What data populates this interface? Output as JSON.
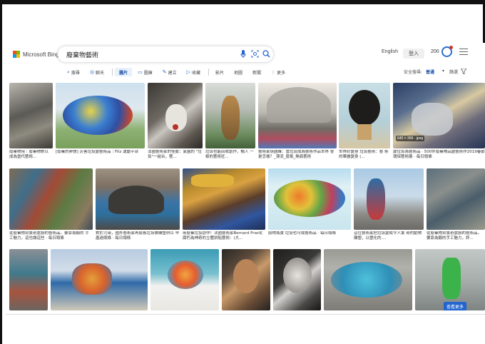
{
  "header": {
    "brand": "Microsoft Bing",
    "search_value": "廢棄物藝術",
    "language": "English",
    "signin": "登入",
    "points": "200"
  },
  "icons": {
    "mic": "microphone-icon",
    "visual": "visual-search-icon",
    "search": "search-icon",
    "reward": "rewards-icon",
    "menu": "hamburger-menu-icon",
    "filter": "filter-icon"
  },
  "colors": {
    "accent": "#2265d0",
    "ms_red": "#f25022",
    "ms_green": "#7fba00",
    "ms_blue": "#00a4ef",
    "ms_yellow": "#ffb900"
  },
  "tabs": [
    {
      "icon": "⌕",
      "label": "搜尋"
    },
    {
      "icon": "◎",
      "label": "聊天"
    },
    {
      "icon": "",
      "label": "圖片",
      "active": true
    },
    {
      "icon": "▭",
      "label": "圖庫"
    },
    {
      "icon": "✎",
      "label": "建立"
    },
    {
      "icon": "▷",
      "label": "收藏"
    },
    {
      "icon": "",
      "label": "影片"
    },
    {
      "icon": "",
      "label": "地圖"
    },
    {
      "icon": "",
      "label": "新聞"
    },
    {
      "icon": "⋮",
      "label": "更多"
    }
  ],
  "tools": {
    "safesearch_label": "安全搜尋:",
    "safesearch_value": "普通",
    "filter_label": "篩選"
  },
  "results": {
    "row1": [
      {
        "caption": "廢棄物用｜廢棄物對以 成為當代藝術..."
      },
      {
        "caption": "[廢棄的夢想] 災害垃圾變藝術品｜Fitz 運動平台"
      },
      {
        "caption": "法國藝術家的怪臉：家園的 \"垃圾\"一組合，藝..."
      },
      {
        "caption": "垃圾也能回收創作，暢人 一條的藝術狂..."
      },
      {
        "caption": "藝術家徐國峰：當垃圾成為藝術作品世界 會是怎樣？_漂流_廢氣_無痕藝術"
      },
      {
        "caption": "世界好變身 垃圾藝術：藝 術的華麗變身 (..."
      },
      {
        "caption": "變垃圾為藝術品 · 500件廢棄物品變藝術作2019春節 環保藝術展 · 每日頭條",
        "badge": "640 × 366 · jpeg"
      }
    ],
    "row2": [
      {
        "caption": "從廢棄物到驚奇震撼的藝術品，要靠為鍛的 手工魅力，這也讓這些 · 每日頭條"
      },
      {
        "caption": "對於污染，國外藝術家再廢舊垃圾做雕塑例以 早產過頭條 · 每日頭條"
      },
      {
        "caption": "用廢棄垃圾創作！法國藝術家Bernard Pras化 腐朽為神奇的立體拼貼藝術：(大..."
      },
      {
        "caption": "廢物為寶 垃圾也可成藝術品 · 每日頭條"
      },
      {
        "caption": "這位藝術家把垃圾變成令人驚 奇的動物雕塑，以塑化的...."
      },
      {
        "caption": "從廢棄物到驚奇震撼的藝術品， 要靠為鍛的手工魅力，評..."
      }
    ],
    "row3": [
      {
        "caption": ""
      },
      {
        "caption": ""
      },
      {
        "caption": ""
      },
      {
        "caption": ""
      },
      {
        "caption": ""
      },
      {
        "caption": ""
      },
      {
        "caption": "",
        "badge": "查看更多"
      }
    ]
  }
}
